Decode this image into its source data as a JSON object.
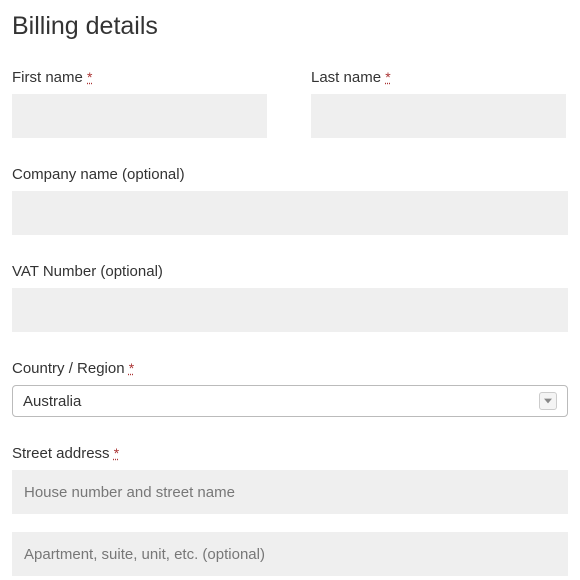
{
  "heading": "Billing details",
  "required_marker": "*",
  "fields": {
    "first_name": {
      "label": "First name",
      "required": true,
      "value": ""
    },
    "last_name": {
      "label": "Last name",
      "required": true,
      "value": ""
    },
    "company": {
      "label": "Company name (optional)",
      "required": false,
      "value": ""
    },
    "vat": {
      "label": "VAT Number (optional)",
      "required": false,
      "value": ""
    },
    "country": {
      "label": "Country / Region",
      "required": true,
      "selected": "Australia"
    },
    "street": {
      "label": "Street address",
      "required": true,
      "placeholder1": "House number and street name",
      "placeholder2": "Apartment, suite, unit, etc. (optional)"
    }
  }
}
